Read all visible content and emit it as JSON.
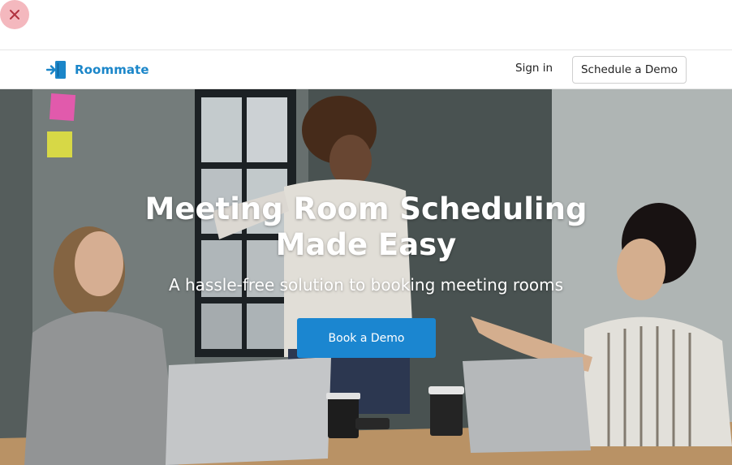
{
  "overlay": {
    "close_icon": "close-x-icon",
    "close_bg": "#f4b8be"
  },
  "navbar": {
    "brand_icon": "door-enter-icon",
    "brand_name": "Roommate",
    "signin_label": "Sign in",
    "demo_label": "Schedule a Demo",
    "accent": "#1b86c9"
  },
  "hero": {
    "headline_line1": "Meeting Room Scheduling",
    "headline_line2": "Made Easy",
    "subheadline": "A hassle-free solution to booking meeting rooms",
    "cta_label": "Book a Demo",
    "cta_color": "#1b86d0",
    "background_image": "office-meeting-photo"
  }
}
